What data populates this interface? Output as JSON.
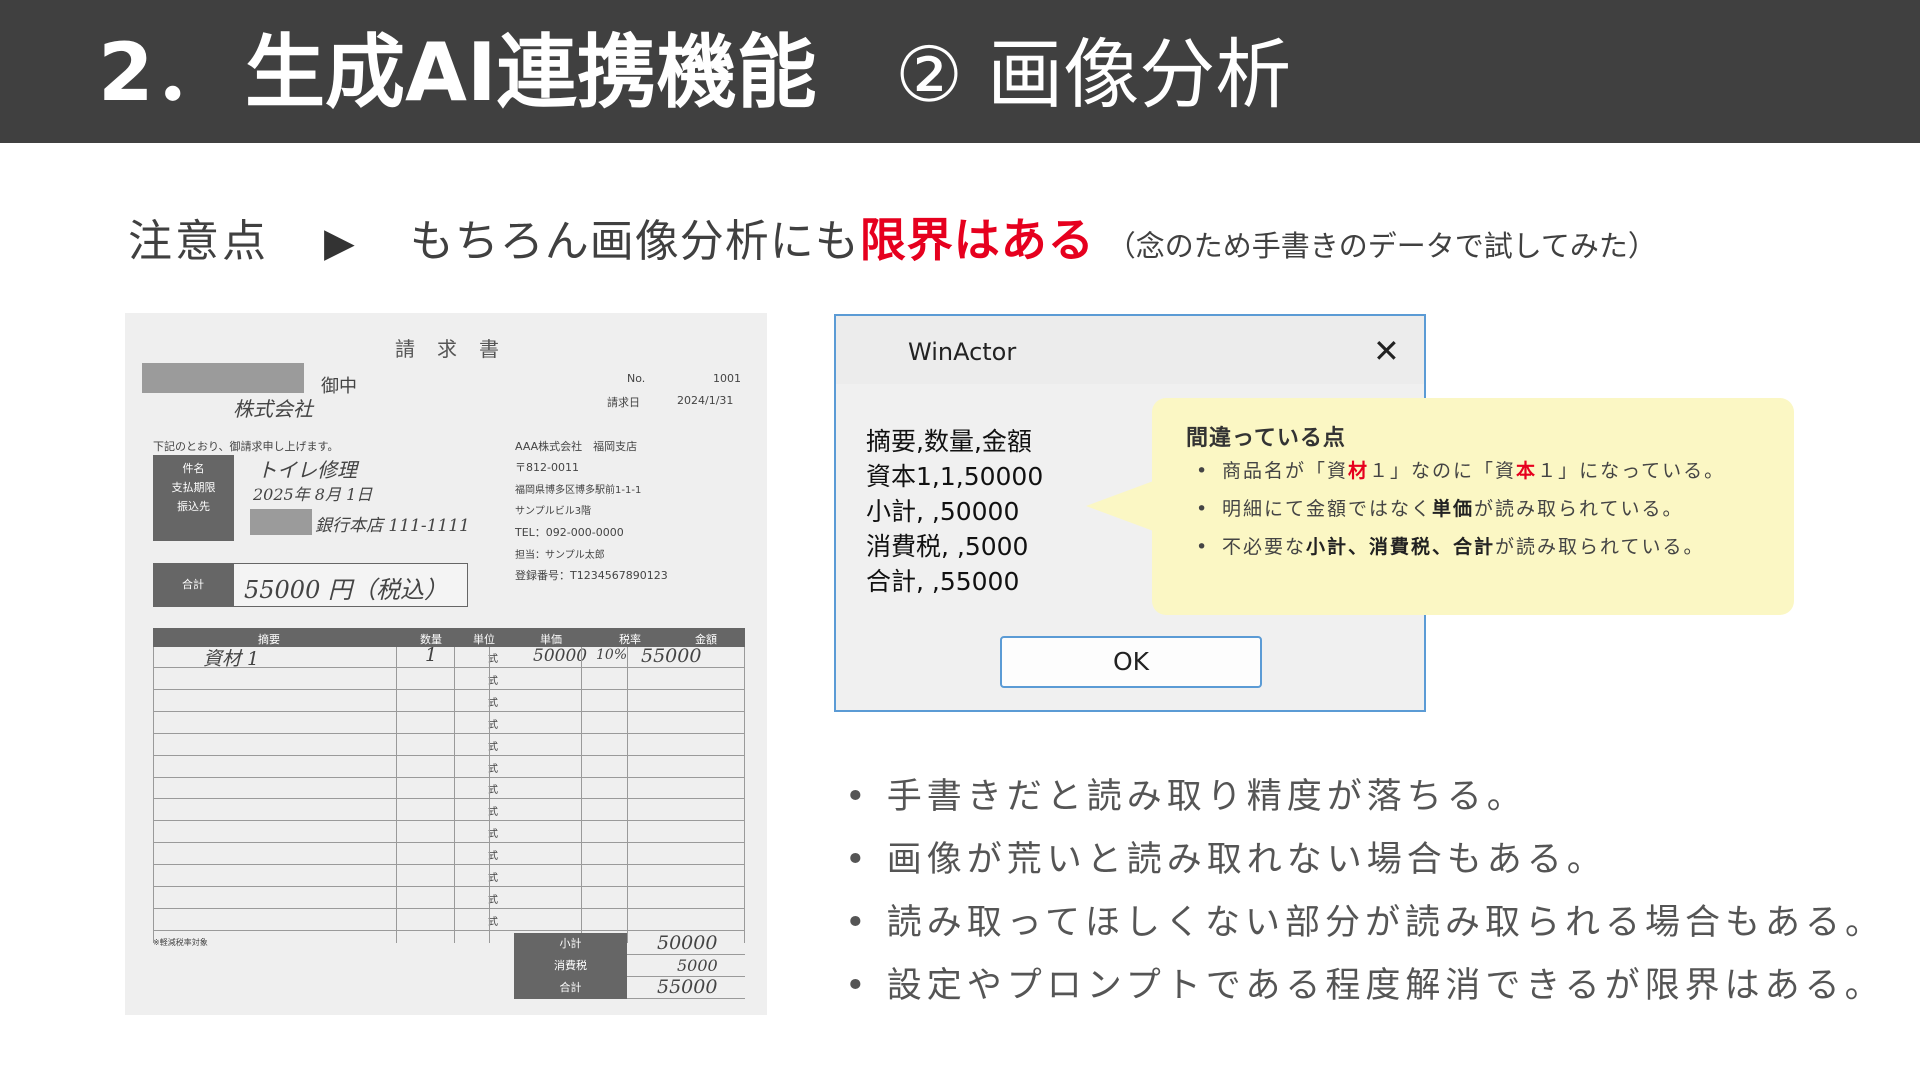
{
  "header": {
    "number": "2．",
    "title": "生成AI連携機能",
    "subtitle": "② 画像分析"
  },
  "note": {
    "label": "注意点",
    "arrow": "▶",
    "body": "もちろん画像分析にも",
    "emphasis": "限界はある",
    "aside": "（念のため手書きのデータで試してみた）"
  },
  "invoice": {
    "title": "請求書",
    "addressee_suffix": "御中",
    "addressee_company": "株式会社",
    "no_label": "No.",
    "no_value": "1001",
    "date_label": "請求日",
    "date_value": "2024/1/31",
    "greeting": "下記のとおり、御請求申し上げます。",
    "fields": [
      {
        "label": "件名",
        "value": "トイレ修理"
      },
      {
        "label": "支払期限",
        "value": "2025年 8月 1日"
      },
      {
        "label": "振込先",
        "value": "銀行本店 111-1111"
      }
    ],
    "issuer": {
      "name": "AAA株式会社　福岡支店",
      "postal": "〒812-0011",
      "address": "福岡県博多区博多駅前1-1-1",
      "building": "サンプルビル3階",
      "tel": "TEL：092-000-0000",
      "person": "担当：サンプル太郎",
      "reg": "登録番号：T1234567890123"
    },
    "total_label": "合計",
    "total_value": "55000 円（税込）",
    "table_headers": [
      "摘要",
      "数量",
      "単位",
      "単価",
      "税率",
      "金額"
    ],
    "first_row": {
      "item": "資材 1",
      "qty": "1",
      "unit": "式",
      "price": "50000",
      "tax": "10%",
      "amount": "55000"
    },
    "unit_word": "式",
    "footnote": "※軽減税率対象",
    "totals": [
      {
        "label": "小計",
        "value": "50000"
      },
      {
        "label": "消費税",
        "value": "5000"
      },
      {
        "label": "合計",
        "value": "55000"
      }
    ]
  },
  "dialog": {
    "title": "WinActor",
    "close": "✕",
    "lines": [
      "摘要,数量,金額",
      "資本1,1,50000",
      "小計, ,50000",
      "消費税, ,5000",
      "合計, ,55000"
    ],
    "ok": "OK"
  },
  "callout": {
    "heading": "間違っている点",
    "items": [
      {
        "a": "商品名が「資",
        "r1": "材",
        "b": "１」なのに「資",
        "r2": "本",
        "c": "１」になっている。"
      },
      {
        "a": "明細にて金額ではなく",
        "bold": "単価",
        "c": "が読み取られている。"
      },
      {
        "a": "不必要な",
        "bold": "小計、消費税、合計",
        "c": "が読み取られている。"
      }
    ]
  },
  "bullets": [
    "手書きだと読み取り精度が落ちる。",
    "画像が荒いと読み取れない場合もある。",
    "読み取ってほしくない部分が読み取られる場合もある。",
    "設定やプロンプトである程度解消できるが限界はある。"
  ],
  "colors": {
    "header_bg": "#404040",
    "accent_red": "#e6001e",
    "callout_bg": "#fbf7c4",
    "dialog_border": "#5b9bd5"
  }
}
